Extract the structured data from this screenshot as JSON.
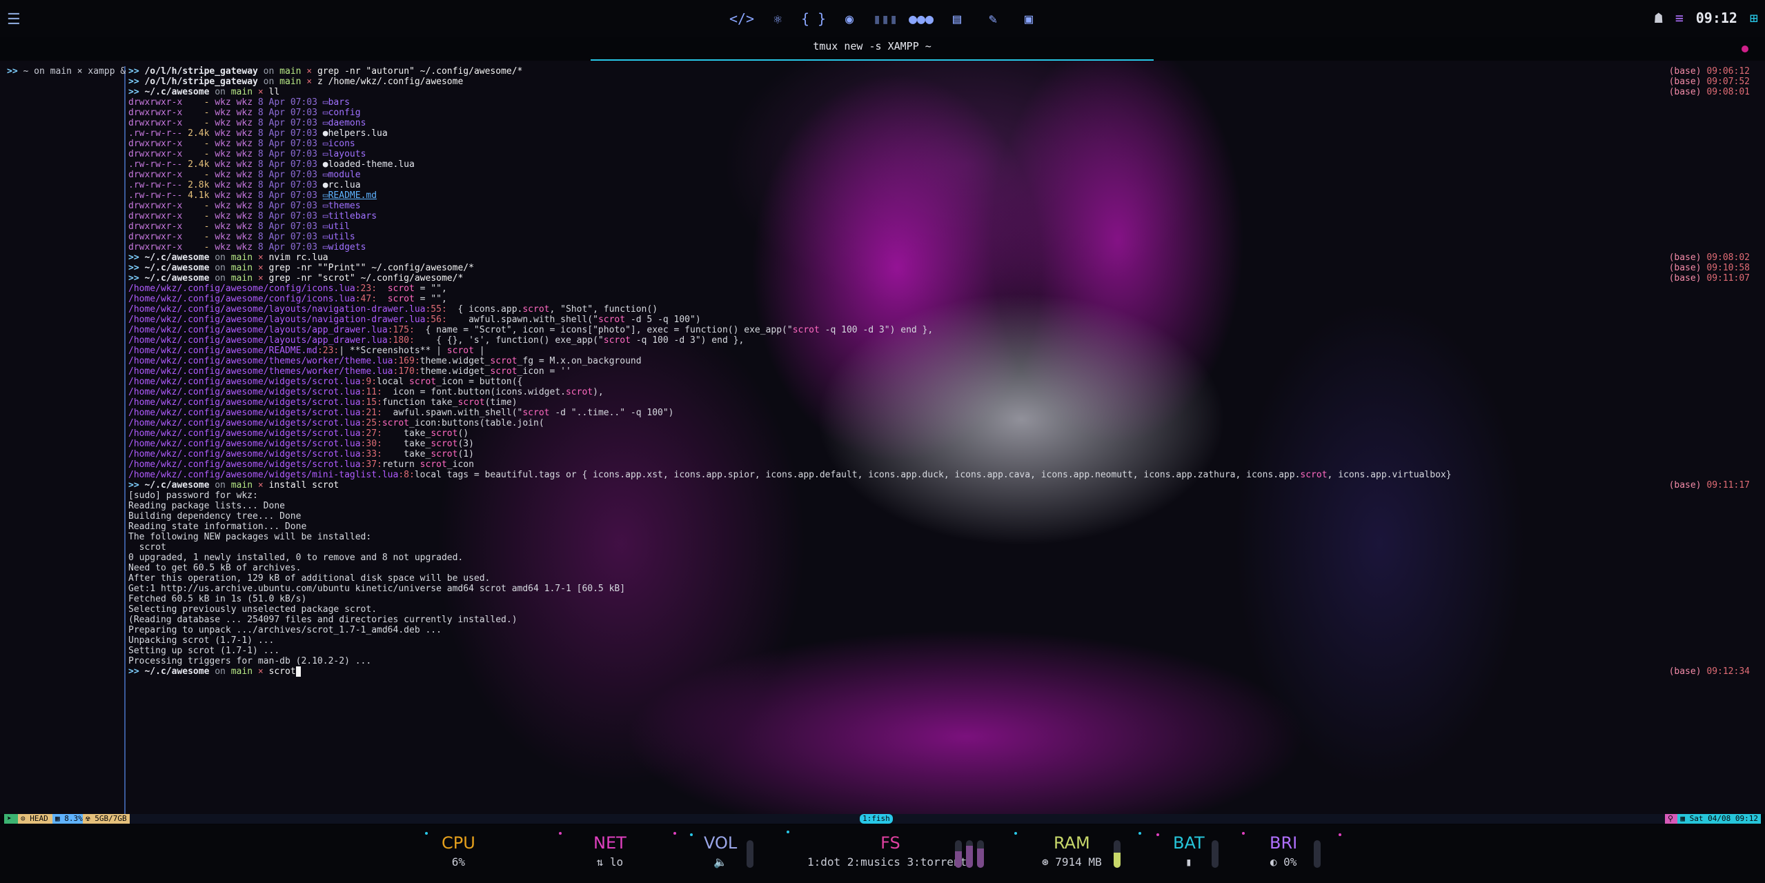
{
  "topbar": {
    "menu_icon": "menu-icon",
    "apps": [
      "code-icon",
      "react-icon",
      "braces-icon",
      "web-icon",
      "audio-icon",
      "chat-icon",
      "document-icon",
      "paint-icon",
      "screen-icon"
    ],
    "clock": "09:12"
  },
  "tmux_title": "tmux new -s XAMPP ~",
  "left_pane": {
    "prompt": "~ on main × xampp &"
  },
  "lines": [
    {
      "k": "p",
      "path": "/o/l/h/stripe_gateway",
      "cmd": "grep -nr \"autorun\" ~/.config/awesome/*",
      "t": "09:06:12"
    },
    {
      "k": "p",
      "path": "/o/l/h/stripe_gateway",
      "cmd": "z /home/wkz/.config/awesome",
      "t": "09:07:52"
    },
    {
      "k": "p",
      "path": "~/.c/awesome",
      "cmd": "ll",
      "t": "09:08:01"
    },
    {
      "k": "ls",
      "perm": "drwxrwxr-x",
      "size": "-",
      "date": "8 Apr 07:03",
      "name": "bars",
      "type": "dir"
    },
    {
      "k": "ls",
      "perm": "drwxrwxr-x",
      "size": "-",
      "date": "8 Apr 07:03",
      "name": "config",
      "type": "dir"
    },
    {
      "k": "ls",
      "perm": "drwxrwxr-x",
      "size": "-",
      "date": "8 Apr 07:03",
      "name": "daemons",
      "type": "dir"
    },
    {
      "k": "ls",
      "perm": ".rw-rw-r--",
      "size": "2.4k",
      "date": "8 Apr 07:03",
      "name": "helpers.lua",
      "type": "file"
    },
    {
      "k": "ls",
      "perm": "drwxrwxr-x",
      "size": "-",
      "date": "8 Apr 07:03",
      "name": "icons",
      "type": "dir"
    },
    {
      "k": "ls",
      "perm": "drwxrwxr-x",
      "size": "-",
      "date": "8 Apr 07:03",
      "name": "layouts",
      "type": "dir"
    },
    {
      "k": "ls",
      "perm": ".rw-rw-r--",
      "size": "2.4k",
      "date": "8 Apr 07:03",
      "name": "loaded-theme.lua",
      "type": "file"
    },
    {
      "k": "ls",
      "perm": "drwxrwxr-x",
      "size": "-",
      "date": "8 Apr 07:03",
      "name": "module",
      "type": "dir"
    },
    {
      "k": "ls",
      "perm": ".rw-rw-r--",
      "size": "2.8k",
      "date": "8 Apr 07:03",
      "name": "rc.lua",
      "type": "file"
    },
    {
      "k": "ls",
      "perm": ".rw-rw-r--",
      "size": "4.1k",
      "date": "8 Apr 07:03",
      "name": "README.md",
      "type": "md"
    },
    {
      "k": "ls",
      "perm": "drwxrwxr-x",
      "size": "-",
      "date": "8 Apr 07:03",
      "name": "themes",
      "type": "dir"
    },
    {
      "k": "ls",
      "perm": "drwxrwxr-x",
      "size": "-",
      "date": "8 Apr 07:03",
      "name": "titlebars",
      "type": "dir"
    },
    {
      "k": "ls",
      "perm": "drwxrwxr-x",
      "size": "-",
      "date": "8 Apr 07:03",
      "name": "util",
      "type": "dir"
    },
    {
      "k": "ls",
      "perm": "drwxrwxr-x",
      "size": "-",
      "date": "8 Apr 07:03",
      "name": "utils",
      "type": "dir"
    },
    {
      "k": "ls",
      "perm": "drwxrwxr-x",
      "size": "-",
      "date": "8 Apr 07:03",
      "name": "widgets",
      "type": "dir"
    },
    {
      "k": "p",
      "path": "~/.c/awesome",
      "cmd": "nvim rc.lua",
      "t": "09:08:02"
    },
    {
      "k": "p",
      "path": "~/.c/awesome",
      "cmd": "grep -nr \"\"Print\"\" ~/.config/awesome/*",
      "t": "09:10:58"
    },
    {
      "k": "p",
      "path": "~/.c/awesome",
      "cmd": "grep -nr \"scrot\" ~/.config/awesome/*",
      "t": "09:11:07"
    },
    {
      "k": "g",
      "path": "/home/wkz/.config/awesome/config/icons.lua",
      "ln": "23",
      "text": "  scrot = \"\","
    },
    {
      "k": "g",
      "path": "/home/wkz/.config/awesome/config/icons.lua",
      "ln": "47",
      "text": "  scrot = \"\","
    },
    {
      "k": "g",
      "path": "/home/wkz/.config/awesome/layouts/navigation-drawer.lua",
      "ln": "55",
      "text": "  { icons.app.scrot, \"Shot\", function()"
    },
    {
      "k": "g",
      "path": "/home/wkz/.config/awesome/layouts/navigation-drawer.lua",
      "ln": "56",
      "text": "    awful.spawn.with_shell(\"scrot -d 5 -q 100\")"
    },
    {
      "k": "g",
      "path": "/home/wkz/.config/awesome/layouts/app_drawer.lua",
      "ln": "175",
      "text": "  { name = \"Scrot\", icon = icons[\"photo\"], exec = function() exe_app(\"scrot -q 100 -d 3\") end },"
    },
    {
      "k": "g",
      "path": "/home/wkz/.config/awesome/layouts/app_drawer.lua",
      "ln": "180",
      "text": "    { {}, 's', function() exe_app(\"scrot -q 100 -d 3\") end },"
    },
    {
      "k": "g",
      "path": "/home/wkz/.config/awesome/README.md",
      "ln": "23",
      "text": "| **Screenshots** | scrot |"
    },
    {
      "k": "g",
      "path": "/home/wkz/.config/awesome/themes/worker/theme.lua",
      "ln": "169",
      "text": "theme.widget_scrot_fg = M.x.on_background"
    },
    {
      "k": "g",
      "path": "/home/wkz/.config/awesome/themes/worker/theme.lua",
      "ln": "170",
      "text": "theme.widget_scrot_icon = ''"
    },
    {
      "k": "g",
      "path": "/home/wkz/.config/awesome/widgets/scrot.lua",
      "ln": "9",
      "text": "local scrot_icon = button({"
    },
    {
      "k": "g",
      "path": "/home/wkz/.config/awesome/widgets/scrot.lua",
      "ln": "11",
      "text": "  icon = font.button(icons.widget.scrot),"
    },
    {
      "k": "g",
      "path": "/home/wkz/.config/awesome/widgets/scrot.lua",
      "ln": "15",
      "text": "function take_scrot(time)"
    },
    {
      "k": "g",
      "path": "/home/wkz/.config/awesome/widgets/scrot.lua",
      "ln": "21",
      "text": "  awful.spawn.with_shell(\"scrot -d \"..time..\" -q 100\")"
    },
    {
      "k": "g",
      "path": "/home/wkz/.config/awesome/widgets/scrot.lua",
      "ln": "25",
      "text": "scrot_icon:buttons(table.join("
    },
    {
      "k": "g",
      "path": "/home/wkz/.config/awesome/widgets/scrot.lua",
      "ln": "27",
      "text": "    take_scrot()"
    },
    {
      "k": "g",
      "path": "/home/wkz/.config/awesome/widgets/scrot.lua",
      "ln": "30",
      "text": "    take_scrot(3)"
    },
    {
      "k": "g",
      "path": "/home/wkz/.config/awesome/widgets/scrot.lua",
      "ln": "33",
      "text": "    take_scrot(1)"
    },
    {
      "k": "g",
      "path": "/home/wkz/.config/awesome/widgets/scrot.lua",
      "ln": "37",
      "text": "return scrot_icon"
    },
    {
      "k": "g",
      "path": "/home/wkz/.config/awesome/widgets/mini-taglist.lua",
      "ln": "8",
      "text": "local tags = beautiful.tags or { icons.app.xst, icons.app.spior, icons.app.default, icons.app.duck, icons.app.cava, icons.app.neomutt, icons.app.zathura, icons.app.scrot, icons.app.virtualbox}"
    },
    {
      "k": "p",
      "path": "~/.c/awesome",
      "cmd": "install scrot",
      "t": "09:11:17"
    },
    {
      "k": "o",
      "text": "[sudo] password for wkz:"
    },
    {
      "k": "o",
      "text": "Reading package lists... Done"
    },
    {
      "k": "o",
      "text": "Building dependency tree... Done"
    },
    {
      "k": "o",
      "text": "Reading state information... Done"
    },
    {
      "k": "o",
      "text": "The following NEW packages will be installed:"
    },
    {
      "k": "o",
      "text": "  scrot"
    },
    {
      "k": "o",
      "text": "0 upgraded, 1 newly installed, 0 to remove and 8 not upgraded."
    },
    {
      "k": "o",
      "text": "Need to get 60.5 kB of archives."
    },
    {
      "k": "o",
      "text": "After this operation, 129 kB of additional disk space will be used."
    },
    {
      "k": "o",
      "text": "Get:1 http://us.archive.ubuntu.com/ubuntu kinetic/universe amd64 scrot amd64 1.7-1 [60.5 kB]"
    },
    {
      "k": "o",
      "text": "Fetched 60.5 kB in 1s (51.0 kB/s)"
    },
    {
      "k": "o",
      "text": "Selecting previously unselected package scrot."
    },
    {
      "k": "o",
      "text": "(Reading database ... 254097 files and directories currently installed.)"
    },
    {
      "k": "o",
      "text": "Preparing to unpack .../archives/scrot_1.7-1_amd64.deb ..."
    },
    {
      "k": "o",
      "text": "Unpacking scrot (1.7-1) ..."
    },
    {
      "k": "o",
      "text": "Setting up scrot (1.7-1) ..."
    },
    {
      "k": "o",
      "text": "Processing triggers for man-db (2.10.2-2) ..."
    },
    {
      "k": "p",
      "path": "~/.c/awesome",
      "cmd": "scrot",
      "t": "09:12:34",
      "cursor": true
    }
  ],
  "prompt_parts": {
    "arrow": ">>",
    "on": "on",
    "branch": "main",
    "x": "×",
    "env": "(base)",
    "user": "wkz wkz"
  },
  "tmux_status": {
    "head": "HEAD",
    "cpu": "8.3%",
    "mem": "5GB/7GB",
    "window": "1:fish",
    "date": "Sat 04/08 09:12"
  },
  "widgets": {
    "cpu": {
      "label": "CPU",
      "value": "6%",
      "color": "#e5a01c"
    },
    "net": {
      "label": "NET",
      "value": "lo",
      "color": "#e040c0"
    },
    "vol": {
      "label": "VOL",
      "color": "#9aa6e8",
      "level": 0.0
    },
    "fs": {
      "label": "FS",
      "value": "1:dot 2:musics 3:torrents",
      "color": "#e040a0"
    },
    "ram": {
      "label": "RAM",
      "value": "7914 MB",
      "color": "#c8d86a",
      "level": 0.55
    },
    "bat": {
      "label": "BAT",
      "color": "#26c6da",
      "level": 0.0
    },
    "bri": {
      "label": "BRI",
      "value": "0%",
      "color": "#b070ff",
      "level": 0.0
    }
  },
  "colors": {
    "accent": "#28c8e8",
    "magenta": "#d0208a"
  }
}
